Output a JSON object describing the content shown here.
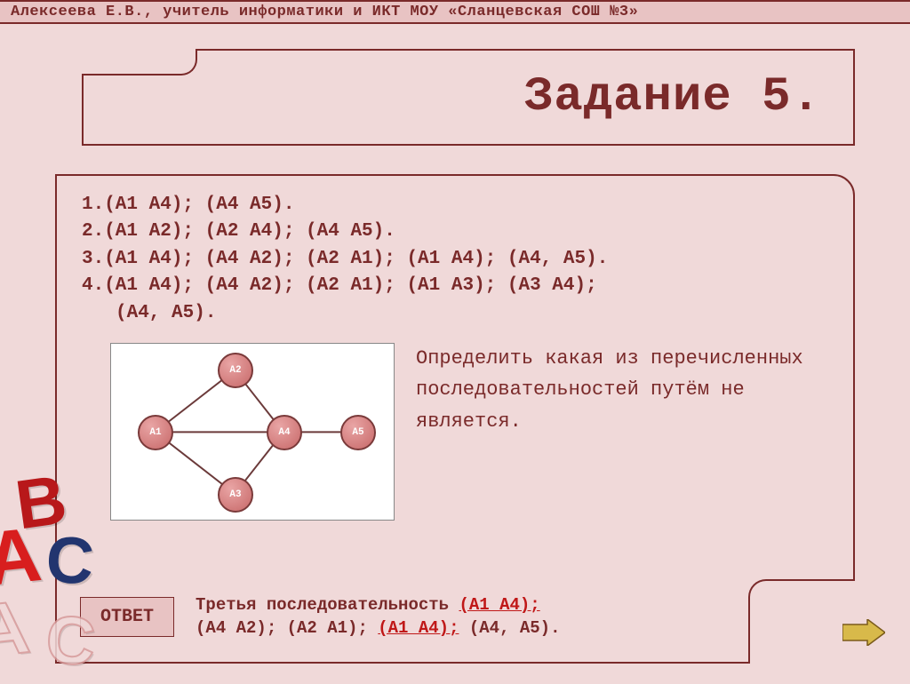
{
  "header": "Алексеева Е.В., учитель информатики и ИКТ МОУ «Сланцевская СОШ №3»",
  "title": "Задание 5.",
  "list": {
    "l1": "1.(А1 А4); (А4 А5).",
    "l2": "2.(А1 А2); (А2 А4); (А4 А5).",
    "l3": "3.(А1 А4); (А4 А2); (А2 А1); (А1 А4); (А4, А5).",
    "l4a": "4.(А1 А4); (А4 А2); (А2 А1); (А1 А3); (А3 А4);",
    "l4b": "(А4, А5)."
  },
  "graph": {
    "nodes": {
      "a1": "А1",
      "a2": "А2",
      "a3": "А3",
      "a4": "А4",
      "a5": "А5"
    },
    "edges": [
      [
        "a1",
        "a2"
      ],
      [
        "a1",
        "a3"
      ],
      [
        "a1",
        "a4"
      ],
      [
        "a2",
        "a4"
      ],
      [
        "a3",
        "a4"
      ],
      [
        "a4",
        "a5"
      ]
    ]
  },
  "question": "Определить какая из перечисленных последовательностей путём не является.",
  "answer": {
    "button": "ОТВЕТ",
    "prefix": "Третья последовательность ",
    "hl1": "(А1 А4);",
    "mid": " (А4 А2); (А2 А1); ",
    "hl2": "(А1 А4);",
    "suffix": " (А4, А5)."
  },
  "decor": {
    "A": "A",
    "B": "B",
    "C": "C"
  }
}
